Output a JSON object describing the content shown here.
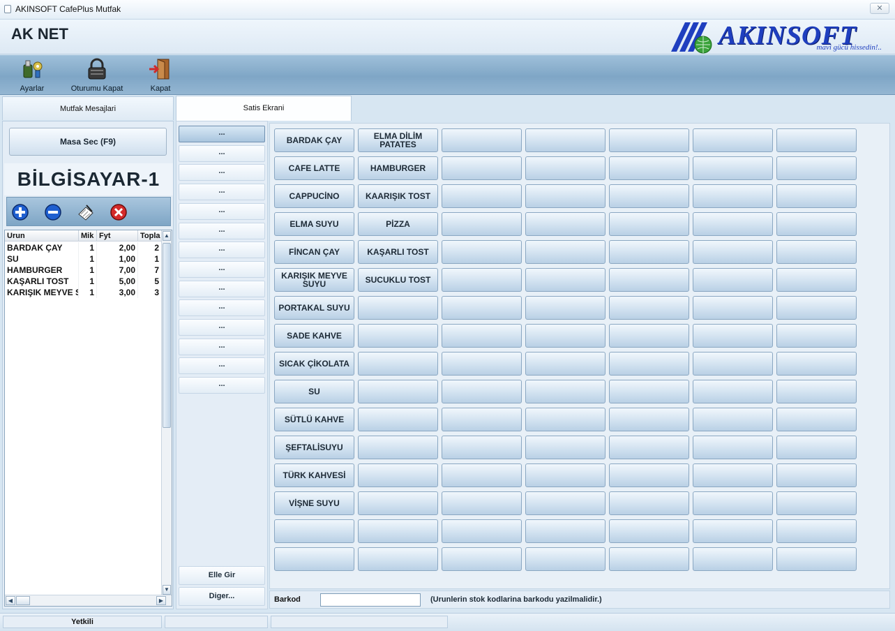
{
  "window": {
    "title": "AKINSOFT CafePlus Mutfak",
    "close_label": "✕"
  },
  "header": {
    "brand": "AK NET"
  },
  "logo": {
    "name": "AKINSOFT",
    "slogan": "mavi gücü hissedin!..",
    "color": "#1f3fbf"
  },
  "toolbar": {
    "items": [
      {
        "label": "Ayarlar",
        "icon": "settings-tools-icon"
      },
      {
        "label": "Oturumu Kapat",
        "icon": "padlock-icon"
      },
      {
        "label": "Kapat",
        "icon": "exit-door-icon"
      }
    ]
  },
  "tabs": [
    {
      "label": "Mutfak Mesajlari",
      "active": false
    },
    {
      "label": "Satis Ekrani",
      "active": true
    }
  ],
  "left_panel": {
    "masa_button": "Masa Sec (F9)",
    "pc_name": "BİLGİSAYAR-1",
    "actions": [
      "add-icon",
      "remove-icon",
      "edit-note-icon",
      "cancel-icon"
    ],
    "table": {
      "headers": [
        "Urun",
        "Mik",
        "Fyt",
        "Topla"
      ],
      "rows": [
        [
          "BARDAK ÇAY",
          "1",
          "2,00",
          "2"
        ],
        [
          "SU",
          "1",
          "1,00",
          "1"
        ],
        [
          "HAMBURGER",
          "1",
          "7,00",
          "7"
        ],
        [
          "KAŞARLI TOST",
          "1",
          "5,00",
          "5"
        ],
        [
          "KARIŞIK MEYVE S",
          "1",
          "3,00",
          "3"
        ]
      ]
    }
  },
  "categories": {
    "items": [
      "...",
      "...",
      "...",
      "...",
      "...",
      "...",
      "...",
      "...",
      "...",
      "...",
      "...",
      "...",
      "...",
      "..."
    ],
    "selected_index": 0,
    "elle_gir": "Elle Gir",
    "diger": "Diger..."
  },
  "products": {
    "columns": [
      [
        "BARDAK ÇAY",
        "CAFE LATTE",
        "CAPPUCİNO",
        "ELMA SUYU",
        "FİNCAN ÇAY",
        "KARIŞIK MEYVE SUYU",
        "PORTAKAL SUYU",
        "SADE KAHVE",
        "SICAK ÇİKOLATA",
        "SU",
        "SÜTLÜ KAHVE",
        "ŞEFTALİSUYU",
        "TÜRK KAHVESİ",
        "VİŞNE SUYU",
        "",
        ""
      ],
      [
        "ELMA DİLİM PATATES",
        "HAMBURGER",
        "KAARIŞIK TOST",
        "PİZZA",
        "KAŞARLI TOST",
        "SUCUKLU TOST",
        "",
        "",
        "",
        "",
        "",
        "",
        "",
        "",
        "",
        ""
      ]
    ],
    "empty_columns": 5,
    "rows": 16
  },
  "barkod": {
    "label": "Barkod",
    "value": "",
    "hint": "(Urunlerin stok kodlarina barkodu yazilmalidir.)"
  },
  "status": {
    "cells": [
      "Yetkili",
      "",
      ""
    ]
  }
}
